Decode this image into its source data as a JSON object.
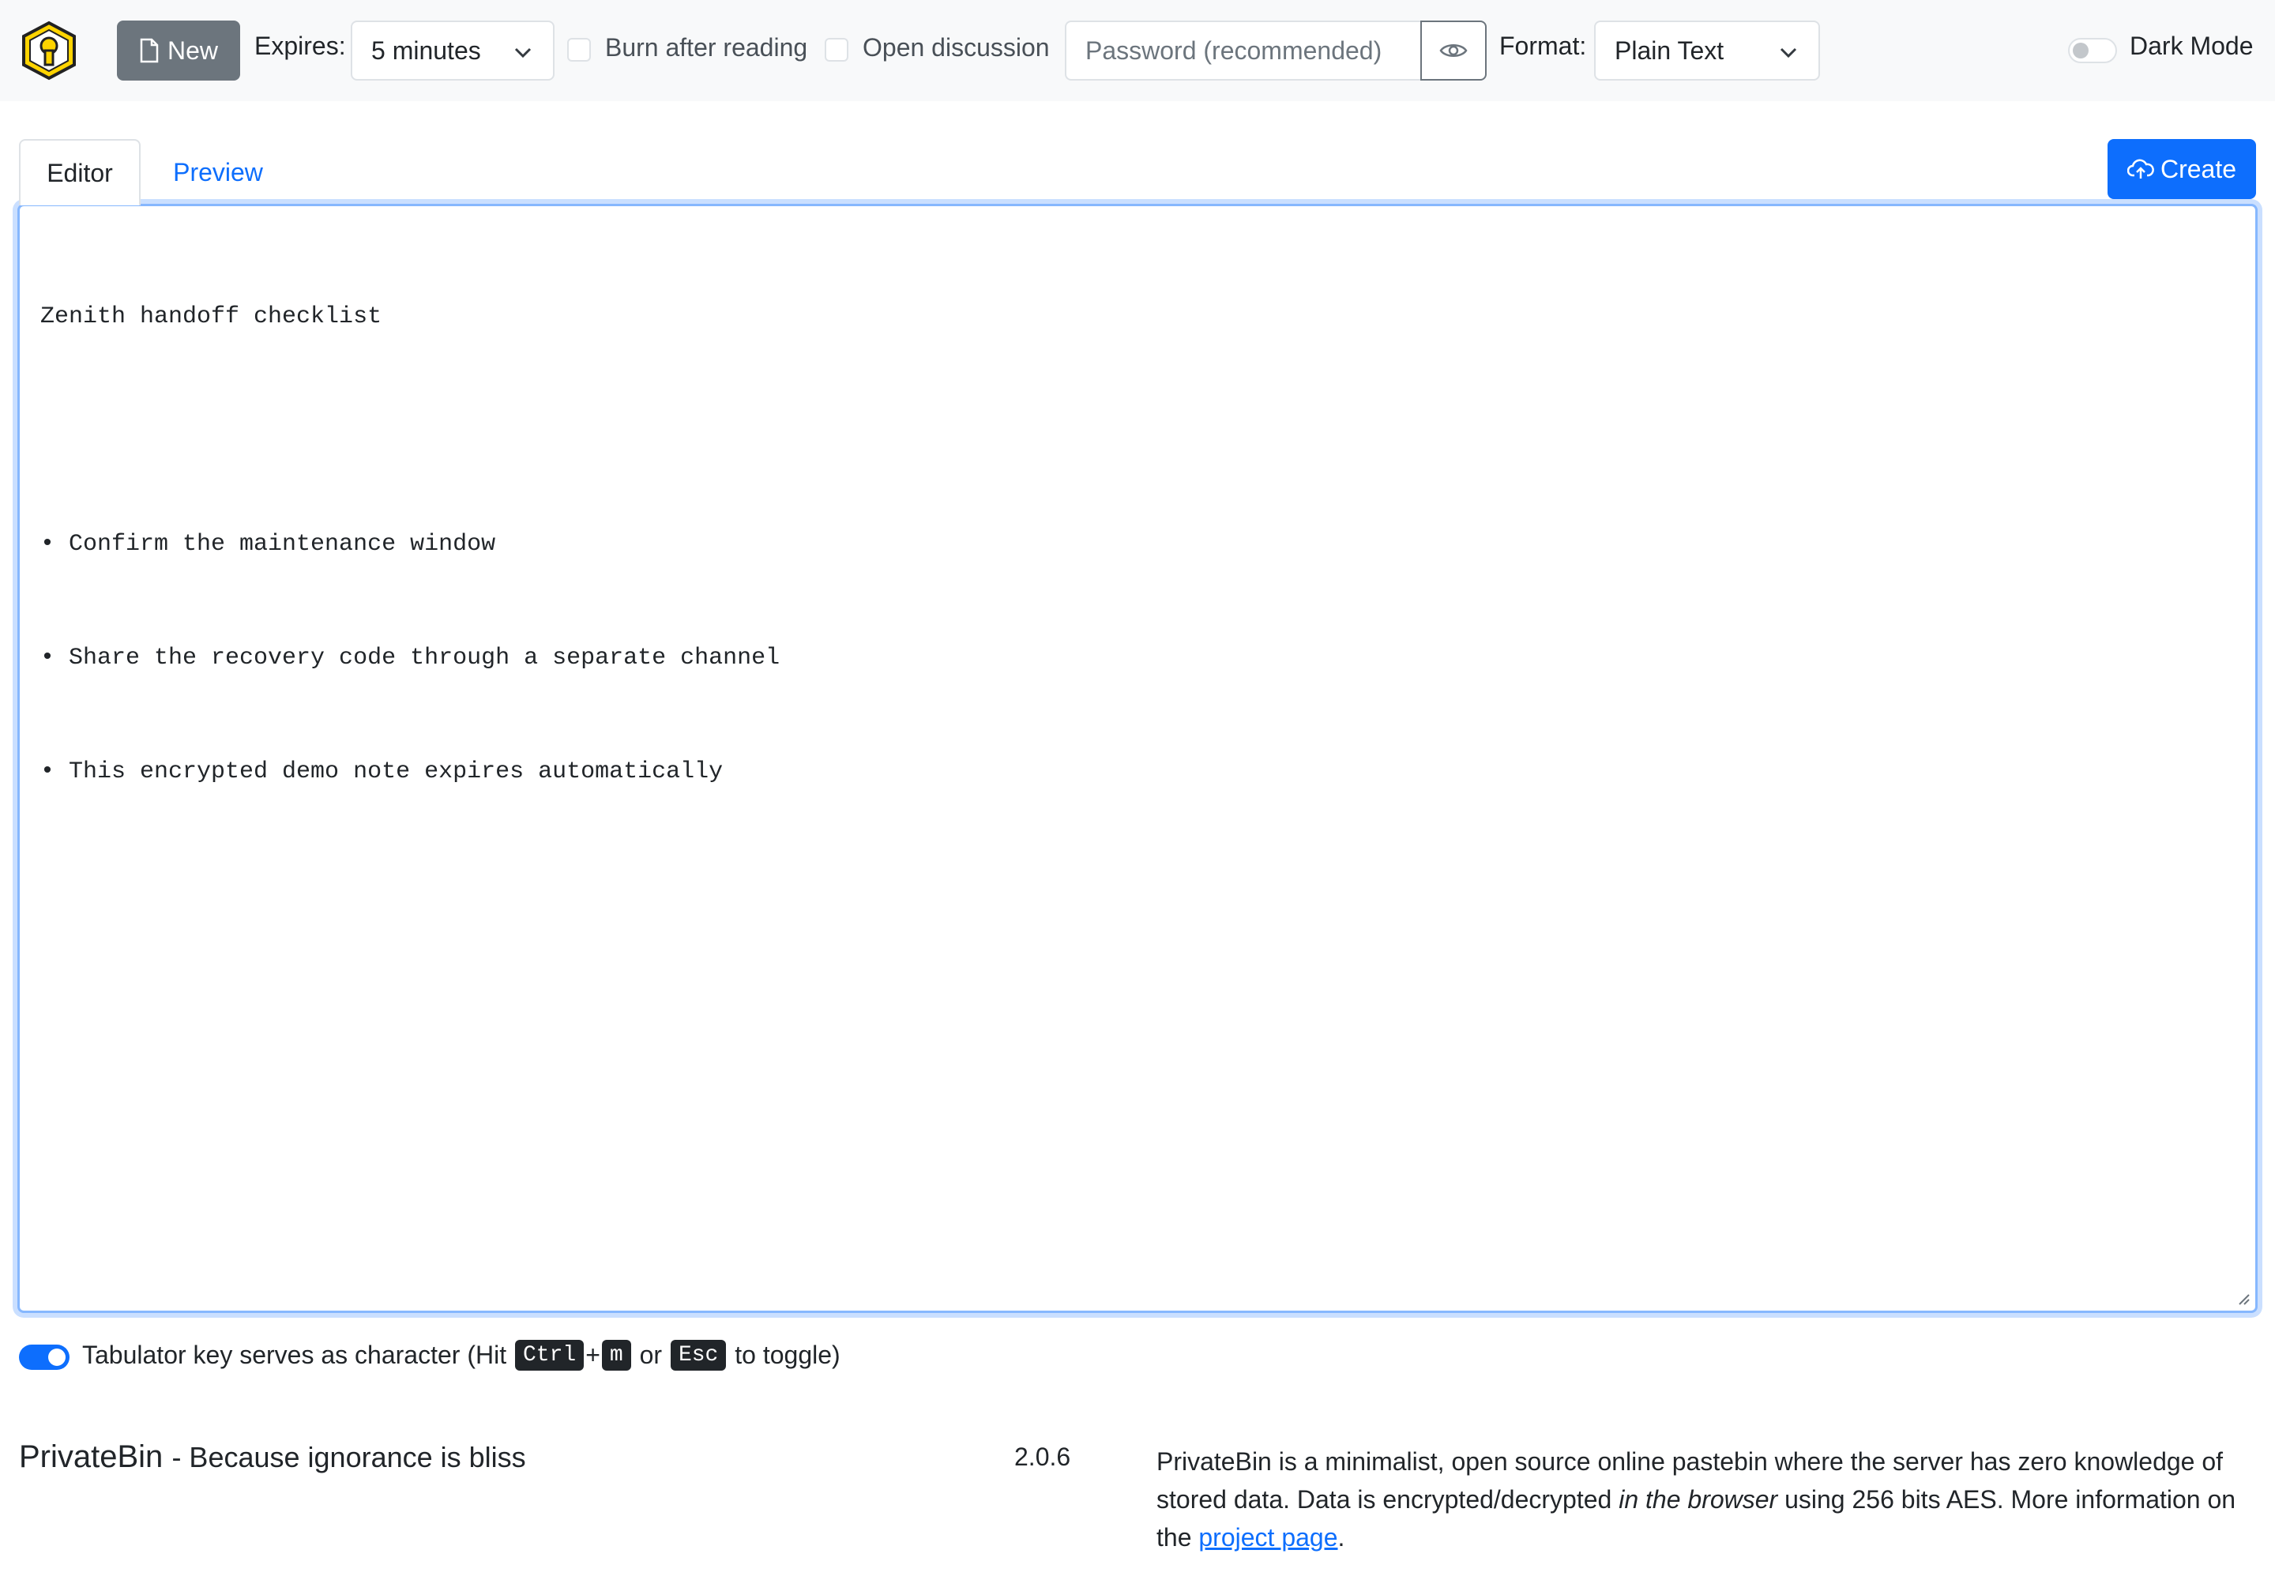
{
  "toolbar": {
    "new_label": "New",
    "expires_label": "Expires:",
    "expires_value": "5 minutes",
    "burn_label": "Burn after reading",
    "discussion_label": "Open discussion",
    "password_placeholder": "Password (recommended)",
    "format_label": "Format:",
    "format_value": "Plain Text",
    "dark_mode_label": "Dark Mode"
  },
  "tabs": {
    "editor": "Editor",
    "preview": "Preview"
  },
  "create_label": "Create",
  "editor": {
    "lines": [
      "Zenith handoff checklist",
      "",
      "• Confirm the maintenance window",
      "• Share the recovery code through a separate channel",
      "• This encrypted demo note expires automatically"
    ]
  },
  "tab_note": {
    "prefix": "Tabulator key serves as character (Hit",
    "key1": "Ctrl",
    "plus": "+",
    "key2": "m",
    "or": "or",
    "key3": "Esc",
    "suffix": "to toggle)"
  },
  "footer": {
    "brand": "PrivateBin",
    "tagline": "- Because ignorance is bliss",
    "version": "2.0.6",
    "about_1": "PrivateBin is a minimalist, open source online pastebin where the server has zero knowledge of stored data. Data is encrypted/decrypted ",
    "about_em": "in the browser",
    "about_2": " using 256 bits AES. More information on the ",
    "about_link": "project page",
    "about_3": "."
  },
  "colors": {
    "primary": "#0d6efd",
    "secondary": "#6c757d",
    "navbar_bg": "#f8f9fa",
    "logo_yellow": "#ffd400"
  },
  "icons": [
    "privatebin-logo-icon",
    "file-icon",
    "chevron-down-icon",
    "eye-icon",
    "cloud-upload-icon"
  ]
}
